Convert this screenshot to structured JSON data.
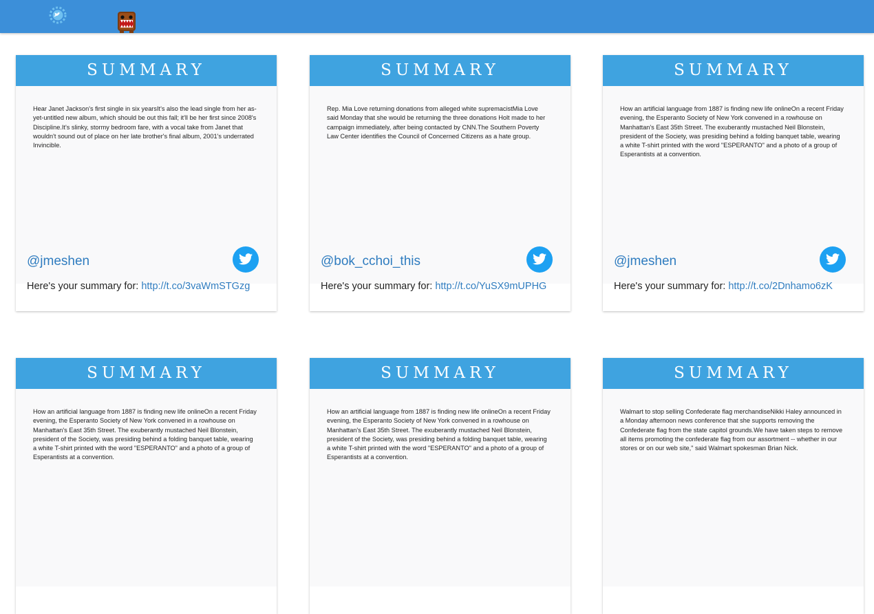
{
  "header": {
    "logo_icon": "twitter-bird-gear-icon",
    "mascot_icon": "domo-mascot-icon",
    "bg_color": "#3c8fd9"
  },
  "cards": [
    {
      "title": "SUMMARY",
      "text": "Hear Janet Jackson's first single in six yearsIt's also the lead single from her as-yet-untitled new album, which should be out this fall; it'll be her first since 2008's Discipline.It's slinky, stormy bedroom fare, with a vocal take from Janet that wouldn't sound out of place on her late brother's final album, 2001's underrated Invincible.",
      "handle": "@jmeshen",
      "prefix": "Here's your summary for: ",
      "link": "http://t.co/3vaWmSTGzg"
    },
    {
      "title": "SUMMARY",
      "text": "Rep. Mia Love returning donations from alleged white supremacistMia Love said Monday that she would be returning the three donations Holt made to her campaign immediately, after being contacted by CNN.The Southern Poverty Law Center identifies the Council of Concerned Citizens as a hate group.",
      "handle": "@bok_cchoi_this",
      "prefix": "Here's your summary for: ",
      "link": "http://t.co/YuSX9mUPHG"
    },
    {
      "title": "SUMMARY",
      "text": "How an artificial language from 1887 is finding new life onlineOn a recent Friday evening, the Esperanto Society of New York convened in a rowhouse on Manhattan's East 35th Street. The exuberantly mustached Neil Blonstein, president of the Society, was presiding behind a folding banquet table, wearing a white T-shirt printed with the word \"ESPERANTO\" and a photo of a group of Esperantists at a convention.",
      "handle": "@jmeshen",
      "prefix": "Here's your summary for: ",
      "link": "http://t.co/2Dnhamo6zK"
    },
    {
      "title": "SUMMARY",
      "text": "How an artificial language from 1887 is finding new life onlineOn a recent Friday evening, the Esperanto Society of New York convened in a rowhouse on Manhattan's East 35th Street. The exuberantly mustached Neil Blonstein, president of the Society, was presiding behind a folding banquet table, wearing a white T-shirt printed with the word \"ESPERANTO\" and a photo of a group of Esperantists at a convention.",
      "handle": "",
      "prefix": "",
      "link": ""
    },
    {
      "title": "SUMMARY",
      "text": "How an artificial language from 1887 is finding new life onlineOn a recent Friday evening, the Esperanto Society of New York convened in a rowhouse on Manhattan's East 35th Street. The exuberantly mustached Neil Blonstein, president of the Society, was presiding behind a folding banquet table, wearing a white T-shirt printed with the word \"ESPERANTO\" and a photo of a group of Esperantists at a convention.",
      "handle": "",
      "prefix": "",
      "link": ""
    },
    {
      "title": "SUMMARY",
      "text": "Walmart to stop selling Confederate flag merchandiseNikki Haley announced in a Monday afternoon news conference that she supports removing the Confederate flag from the state capitol grounds.We have taken steps to remove all items promoting the confederate flag from our assortment -- whether in our stores or on our web site,\" said Walmart spokesman Brian Nick.",
      "handle": "",
      "prefix": "",
      "link": ""
    }
  ],
  "colors": {
    "card_header": "#3fa3e0",
    "link": "#2f7cbf",
    "twitter_button": "#1da1f2"
  }
}
